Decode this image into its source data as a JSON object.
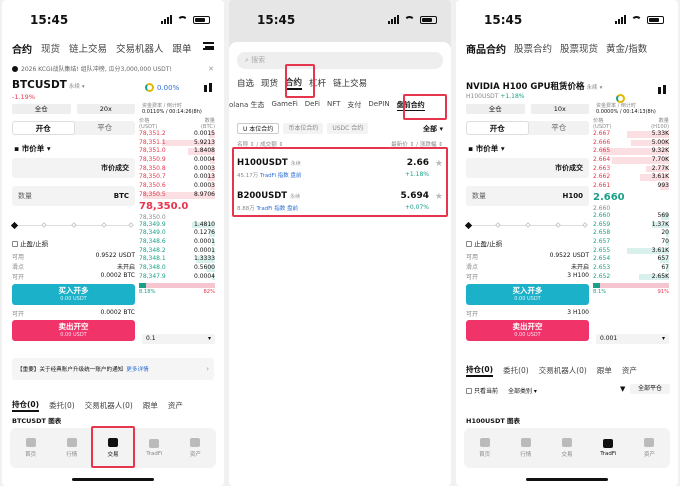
{
  "status": {
    "time": "15:45"
  },
  "p1": {
    "tabs": [
      "合约",
      "现货",
      "链上交易",
      "交易机器人",
      "跟单"
    ],
    "banner": "2026 KCGI战队集结! 组队冲榜, 瓜分3,000,000 USDT!",
    "pair": "BTCUSDT",
    "pair_tag": "永续",
    "change": "-1.19%",
    "ring_text": "0.00%",
    "margin_mode": "全仓",
    "leverage": "20x",
    "funding_label": "资金费率 / 倒计时",
    "funding_value": "0.0110% / 00:14:26(8h)",
    "seg": [
      "开仓",
      "平仓"
    ],
    "order_type": "市价单",
    "price_placeholder": "市价成交",
    "qty_label": "数量",
    "qty_unit": "BTC",
    "tpsl": "止盈/止损",
    "avail_label": "可用",
    "avail_value": "0.9522 USDT",
    "slip_label": "滑点",
    "slip_value": "未开启",
    "canopen_label": "可开",
    "canopen_value": "0.0002 BTC",
    "buy": "买入开多",
    "buy_sub": "0.00 USDT",
    "canopen2_value": "0.0002 BTC",
    "sell": "卖出开空",
    "sell_sub": "0.00 USDT",
    "ob_head": {
      "price": "价格",
      "price_unit": "(USDT)",
      "qty": "数量",
      "qty_unit": "(BTC)"
    },
    "asks": [
      [
        "78,351.2",
        "0.0015"
      ],
      [
        "78,351.1",
        "5.9213"
      ],
      [
        "78,351.0",
        "1.8408"
      ],
      [
        "78,350.9",
        "0.0004"
      ],
      [
        "78,350.8",
        "0.0003"
      ],
      [
        "78,350.7",
        "0.0013"
      ],
      [
        "78,350.6",
        "0.0003"
      ],
      [
        "78,350.5",
        "8.9706"
      ]
    ],
    "mid": "78,350.0",
    "mid_sub": "78,350.0",
    "bids": [
      [
        "78,349.9",
        "1.4810"
      ],
      [
        "78,349.0",
        "0.1276"
      ],
      [
        "78,348.6",
        "0.0001"
      ],
      [
        "78,348.2",
        "0.0001"
      ],
      [
        "78,348.1",
        "1.3333"
      ],
      [
        "78,348.0",
        "0.5600"
      ],
      [
        "78,347.9",
        "0.0004"
      ]
    ],
    "ratio_buy": "8.18%",
    "ratio_sell": "82%",
    "tick": "0.1",
    "notice": "【重要】关于经典账户升级统一账户的通知",
    "notice_link": "更多详情",
    "btabs": [
      "持仓(0)",
      "委托(0)",
      "交易机器人(0)",
      "跟单",
      "资产"
    ],
    "chart_title": "BTCUSDT 图表",
    "nav": [
      "首页",
      "行情",
      "交易",
      "TradFi",
      "资产"
    ]
  },
  "p2": {
    "search": "搜索",
    "tabs": [
      "自选",
      "现货",
      "合约",
      "杠杆",
      "链上交易"
    ],
    "sub": [
      "olana 生态",
      "GameFi",
      "DeFi",
      "NFT",
      "支付",
      "DePIN",
      "盘前合约"
    ],
    "chips": [
      "U 本位合约",
      "币本位合约",
      "USDC 合约"
    ],
    "all": "全部",
    "colh": [
      "名称 ⇕ / 成交额 ⇕",
      "最新价 ⇕ / 涨跌幅 ⇕"
    ],
    "items": [
      {
        "name": "H100USDT",
        "tag": "永续",
        "vol": "45.17万",
        "t1": "TradFi",
        "t2": "指数",
        "t3": "盘前",
        "price": "2.66",
        "change": "+1.18%"
      },
      {
        "name": "B200USDT",
        "tag": "永续",
        "vol": "8.88万",
        "t1": "TradFi",
        "t2": "指数",
        "t3": "盘前",
        "price": "5.694",
        "change": "+0.07%"
      }
    ]
  },
  "p3": {
    "tabs": [
      "商品合约",
      "股票合约",
      "股票现货",
      "黄金/指数"
    ],
    "pair": "NVIDIA H100 GPU租赁价格",
    "pair_tag": "永续",
    "code": "H100USDT",
    "change": "+1.18%",
    "margin_mode": "全仓",
    "leverage": "10x",
    "funding_label": "资金费率 / 倒计时",
    "funding_value": "0.0000% / 00:14:13(8h)",
    "seg": [
      "开仓",
      "平仓"
    ],
    "order_type": "市价单",
    "price_placeholder": "市价成交",
    "qty_label": "数量",
    "qty_unit": "H100",
    "tpsl": "止盈/止损",
    "avail_label": "可用",
    "avail_value": "0.9522 USDT",
    "slip_label": "滑点",
    "slip_value": "未开启",
    "canopen_label": "可开",
    "canopen_value": "3 H100",
    "buy": "买入开多",
    "buy_sub": "0.00 USDT",
    "canopen2_value": "3 H100",
    "sell": "卖出开空",
    "sell_sub": "0.00 USDT",
    "ob_head": {
      "price": "价格",
      "price_unit": "(USDT)",
      "qty": "数量",
      "qty_unit": "(H100)"
    },
    "asks": [
      [
        "2.667",
        "5.33K"
      ],
      [
        "2.666",
        "5.00K"
      ],
      [
        "2.665",
        "9.32K"
      ],
      [
        "2.664",
        "7.70K"
      ],
      [
        "2.663",
        "2.77K"
      ],
      [
        "2.662",
        "3.61K"
      ],
      [
        "2.661",
        "993"
      ]
    ],
    "mid": "2.660",
    "mid_sub": "2.660",
    "bids": [
      [
        "2.660",
        "569"
      ],
      [
        "2.659",
        "1.37K"
      ],
      [
        "2.658",
        "20"
      ],
      [
        "2.657",
        "70"
      ],
      [
        "2.655",
        "3.61K"
      ],
      [
        "2.654",
        "657"
      ],
      [
        "2.653",
        "67"
      ],
      [
        "2.652",
        "2.65K"
      ]
    ],
    "ratio_buy": "8.1%",
    "ratio_sell": "91%",
    "tick": "0.001",
    "btabs": [
      "持仓(0)",
      "委托(0)",
      "交易机器人(0)",
      "跟单",
      "资产"
    ],
    "hide_label": "只看当前",
    "all_label": "全部类别",
    "close_all": "全部平仓",
    "chart_title": "H100USDT 图表",
    "nav": [
      "首页",
      "行情",
      "交易",
      "TradFi",
      "资产"
    ]
  }
}
